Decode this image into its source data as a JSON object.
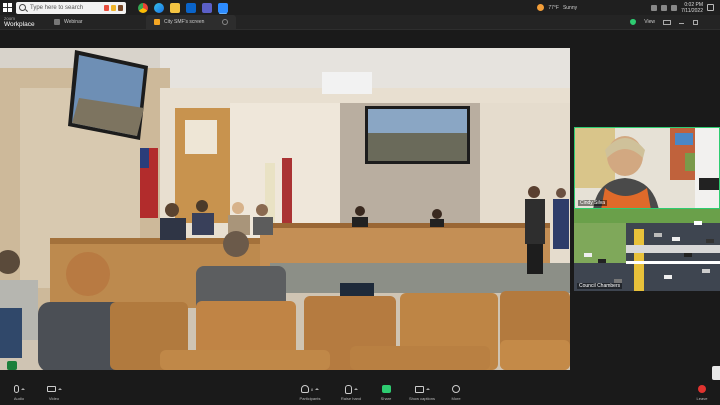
{
  "taskbar": {
    "search_placeholder": "Type here to search",
    "weather_temp": "77°F",
    "weather_desc": "Sunny",
    "time": "0:02 PM",
    "date": "7/11/2022",
    "apps": [
      "chrome-icon",
      "edge-icon",
      "file-explorer-icon",
      "outlook-icon",
      "teams-icon",
      "zoom-icon"
    ]
  },
  "zoom": {
    "brand_line1": "zoom",
    "brand_line2": "Workplace",
    "tabs": [
      {
        "label": "Webinar"
      },
      {
        "label": "City SMF's screen"
      }
    ],
    "view_label": "View"
  },
  "participants": [
    {
      "name": "Cindy Silva"
    },
    {
      "name": "Council Chambers"
    }
  ],
  "toolbar": {
    "audio": "Audio",
    "video": "Video",
    "participants": "Participants",
    "participants_count": "8",
    "raise_hand": "Raise hand",
    "share": "Share",
    "captions": "Show captions",
    "more": "More",
    "leave": "Leave"
  },
  "colors": {
    "accent_green": "#2ecc71",
    "leave_red": "#e0332f",
    "toolbar_bg": "#1a1a1a"
  }
}
